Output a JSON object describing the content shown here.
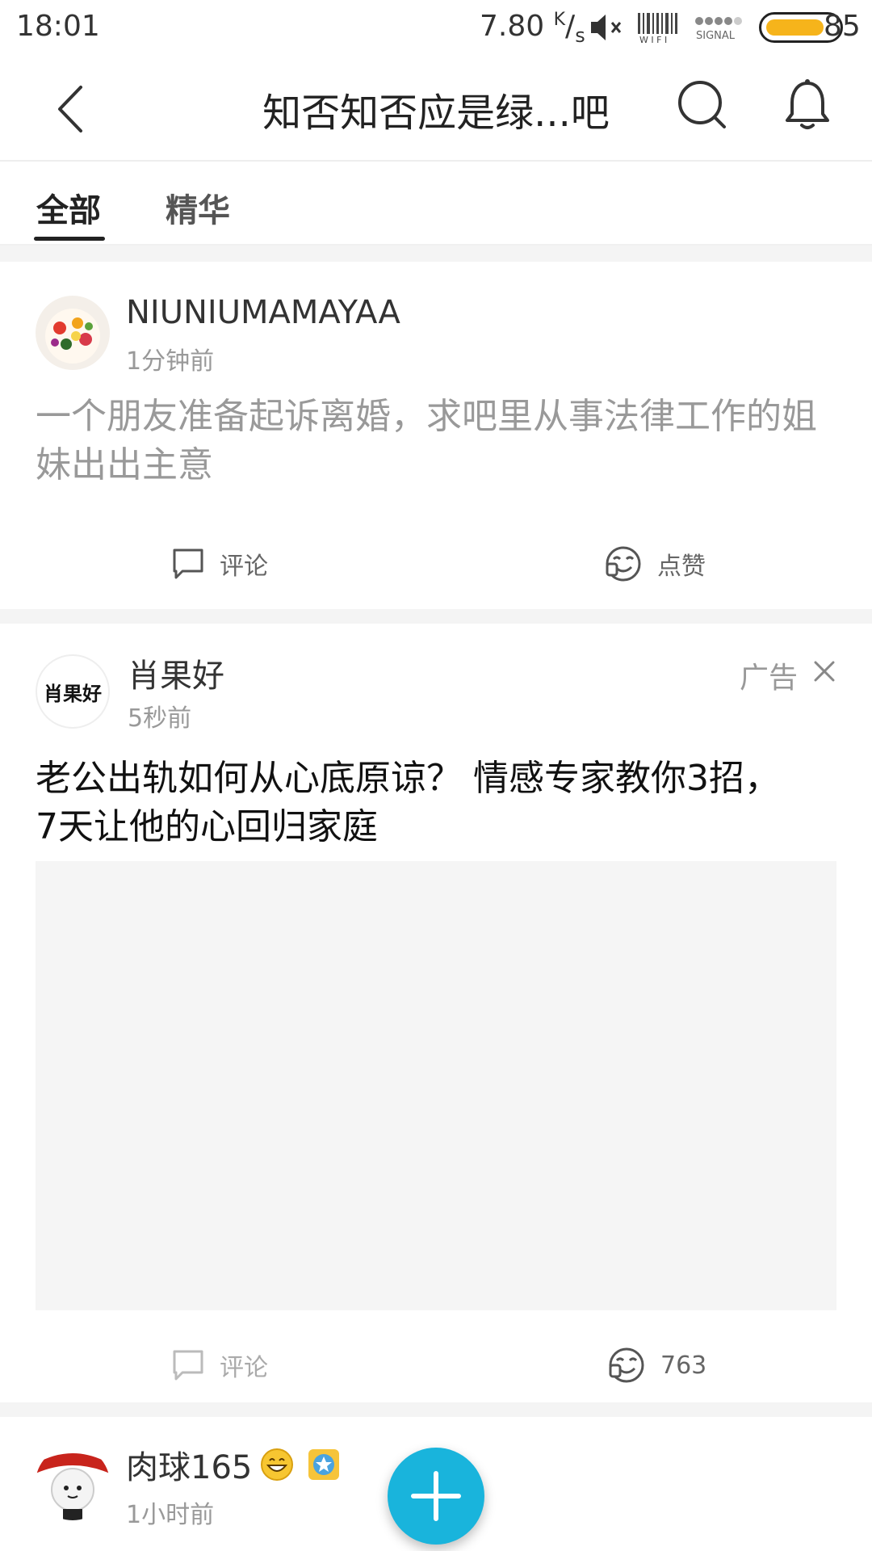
{
  "status_bar": {
    "time": "18:01",
    "net_speed": "7.80",
    "net_unit_top": "K",
    "net_unit_bottom": "s",
    "battery_level": "85",
    "battery_color": "#f6b41b",
    "icons": [
      "mute-icon",
      "wifi-icon",
      "signal-4g-icon",
      "battery-icon"
    ]
  },
  "header": {
    "title": "知否知否应是绿...吧",
    "icons": [
      "back-arrow-icon",
      "search-icon",
      "bell-icon"
    ]
  },
  "tabs": [
    {
      "label": "全部",
      "active": true
    },
    {
      "label": "精华",
      "active": false
    }
  ],
  "posts": [
    {
      "username": "NIUNIUMAMAYAA",
      "time": "1分钟前",
      "text": "一个朋友准备起诉离婚，求吧里从事法律工作的姐妹出出主意",
      "comment_label": "评论",
      "like_label": "点赞"
    },
    {
      "username": "肖果好",
      "avatar_text": "肖果好",
      "time": "5秒前",
      "ad_label": "广告",
      "text": "老公出轨如何从心底原谅？  情感专家教你3招， 7天让他的心回归家庭",
      "comment_label": "评论",
      "like_count": "763"
    },
    {
      "username": "肉球165",
      "time": "1小时前"
    }
  ],
  "fab": {
    "icon": "plus-icon",
    "color": "#19b4dc"
  }
}
